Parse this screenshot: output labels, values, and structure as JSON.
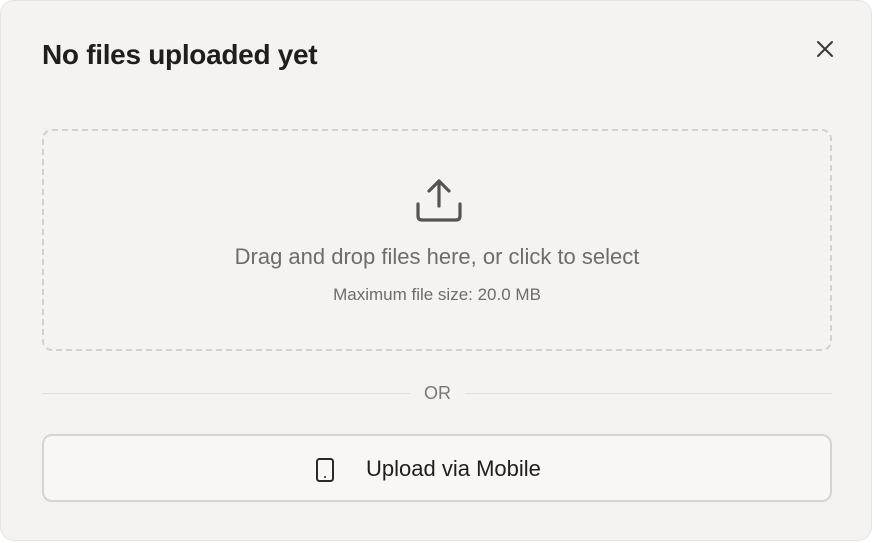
{
  "dialog": {
    "title": "No files uploaded yet",
    "close_icon": "close-icon"
  },
  "dropzone": {
    "icon": "upload-icon",
    "instruction": "Drag and drop files here, or click to select",
    "max_size": "Maximum file size: 20.0 MB"
  },
  "divider": {
    "label": "OR"
  },
  "mobile_upload": {
    "icon": "phone-icon",
    "label": "Upload via Mobile"
  },
  "colors": {
    "background": "#f4f3f1",
    "text_primary": "#1f1e1c",
    "text_secondary": "#6e6c68",
    "border": "#d3d1cd"
  }
}
